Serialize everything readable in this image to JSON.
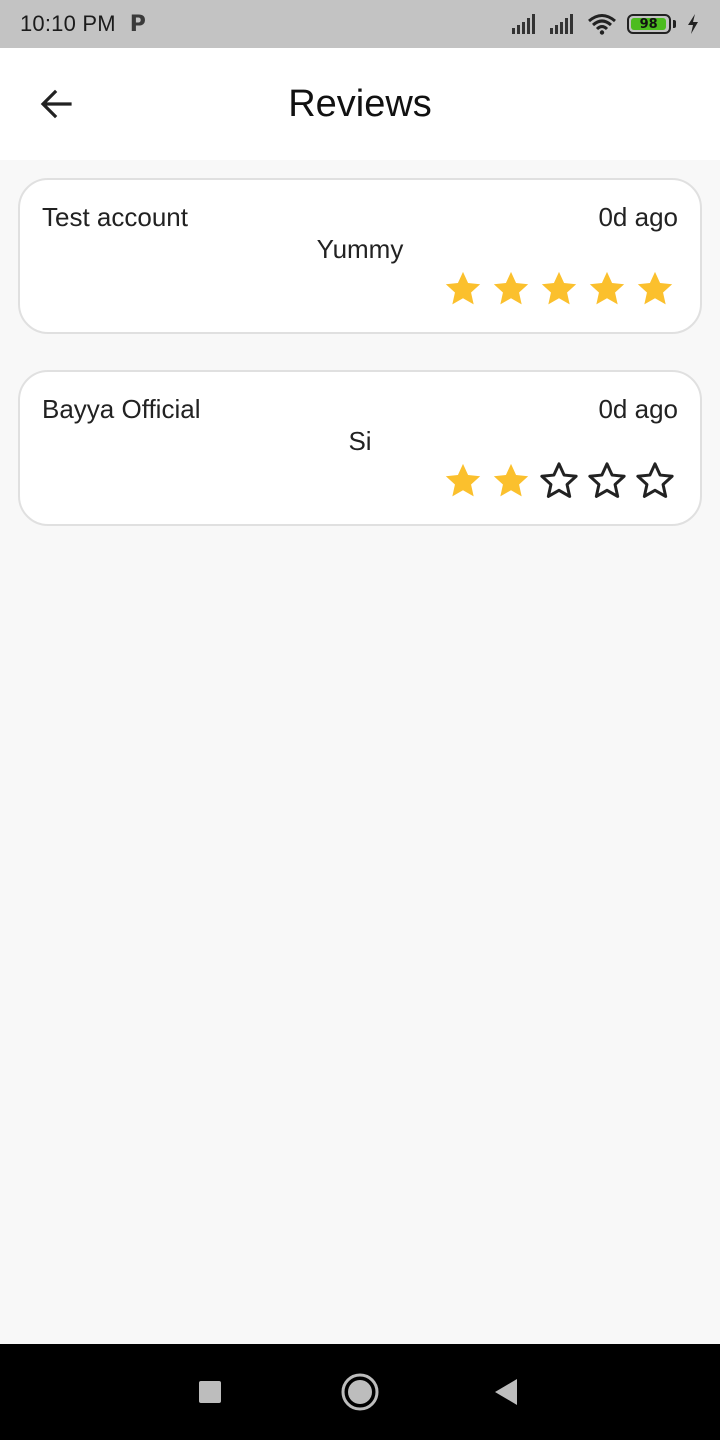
{
  "status_bar": {
    "time": "10:10 PM",
    "notification_icon": "p-icon",
    "battery_level": "98",
    "battery_fraction": 0.98,
    "icons": [
      "signal-icon",
      "signal-icon",
      "wifi-icon",
      "battery-icon",
      "charging-icon"
    ]
  },
  "app_bar": {
    "title": "Reviews",
    "back_icon": "arrow-back-icon"
  },
  "colors": {
    "star_filled": "#FBC02D",
    "star_empty_stroke": "#222222",
    "status_bar_bg": "#C3C3C3",
    "battery_fill": "#4CBC1F"
  },
  "reviews": [
    {
      "name": "Test account",
      "time": "0d ago",
      "text": "Yummy",
      "rating": 5,
      "max_rating": 5
    },
    {
      "name": "Bayya Official",
      "time": "0d ago",
      "text": "Si",
      "rating": 2,
      "max_rating": 5
    }
  ],
  "nav_bar": {
    "icons": [
      "recents-square-icon",
      "home-circle-icon",
      "back-triangle-icon"
    ]
  }
}
